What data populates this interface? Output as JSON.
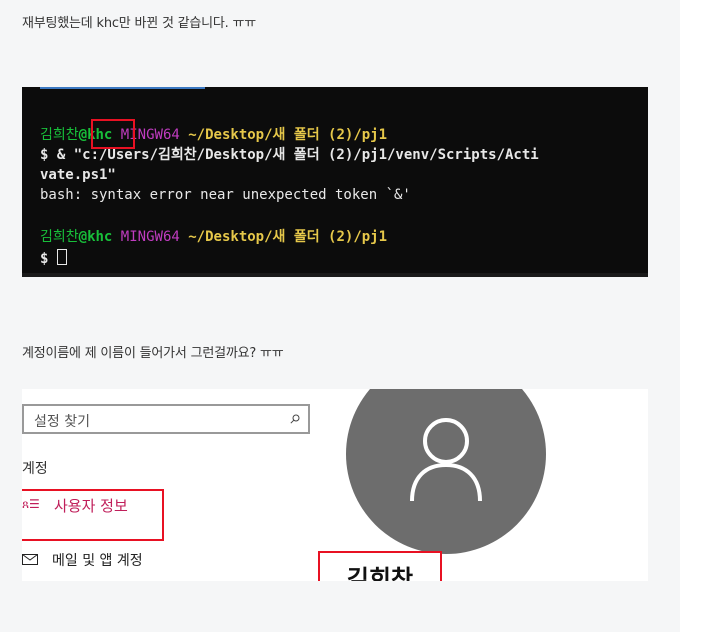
{
  "post": {
    "paragraph_1": "재부팅했는데 khc만 바뀐 것 같습니다. ㅠㅠ",
    "paragraph_2": "계정이름에 제 이름이 들어가서 그런걸까요? ㅠㅠ"
  },
  "terminal": {
    "prompt_1": {
      "username": "김희찬",
      "host": "@khc",
      "system": "MINGW64",
      "path": "~/Desktop/새 폴더 (2)/pj1"
    },
    "command_line_1": "$ & \"c:/Users/김희찬/Desktop/새 폴더 (2)/pj1/venv/Scripts/Acti",
    "command_line_2": "vate.ps1\"",
    "error_line": "bash: syntax error near unexpected token `&'",
    "prompt_2": {
      "username": "김희찬",
      "host": "@khc",
      "system": "MINGW64",
      "path": "~/Desktop/새 폴더 (2)/pj1"
    },
    "input_prompt": "$ "
  },
  "settings": {
    "search_placeholder": "설정 찾기",
    "section_heading": "계정",
    "nav_user_info": {
      "icon": "person-list-icon",
      "icon_glyph": "ጸ☰",
      "label": "사용자 정보"
    },
    "nav_email": {
      "icon": "mail-icon",
      "label": "메일 및 앱 계정"
    },
    "display_name": "김희찬"
  },
  "colors": {
    "terminal_bg": "#0c0c0c",
    "prompt_green": "#18c03a",
    "prompt_magenta": "#c03cc0",
    "prompt_yellow": "#e6c84a",
    "highlight_red": "#e81123",
    "settings_accent": "#c01e5a",
    "avatar_gray": "#6d6d6d"
  }
}
